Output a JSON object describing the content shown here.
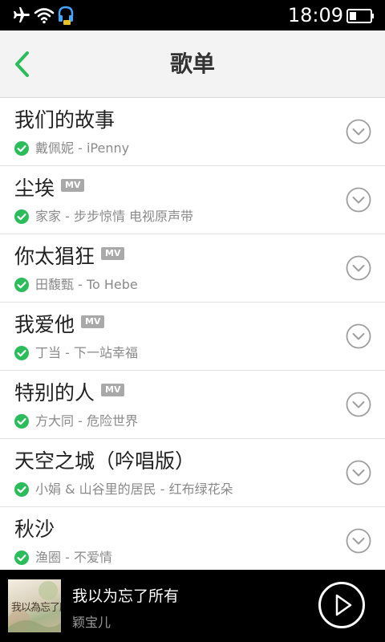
{
  "status_bar": {
    "time": "18:09",
    "icons": [
      "airplane-icon",
      "wifi-icon",
      "headset-notification-icon",
      "battery-icon"
    ]
  },
  "header": {
    "title": "歌单",
    "back_icon": "chevron-left-icon"
  },
  "colors": {
    "accent_green": "#2bbd5a",
    "mv_badge": "#a9a9a9"
  },
  "songs": [
    {
      "title": "我们的故事",
      "mv": false,
      "subtitle": "戴佩妮 - iPenny"
    },
    {
      "title": "尘埃",
      "mv": true,
      "mv_label": "MV",
      "subtitle": "家家 - 步步惊情 电视原声带"
    },
    {
      "title": "你太猖狂",
      "mv": true,
      "mv_label": "MV",
      "subtitle": "田馥甄 - To Hebe"
    },
    {
      "title": "我爱他",
      "mv": true,
      "mv_label": "MV",
      "subtitle": "丁当 - 下一站幸福"
    },
    {
      "title": "特别的人",
      "mv": true,
      "mv_label": "MV",
      "subtitle": "方大同 - 危险世界"
    },
    {
      "title": "天空之城（吟唱版）",
      "mv": false,
      "subtitle": "小娟 & 山谷里的居民 - 红布绿花朵"
    },
    {
      "title": "秋沙",
      "mv": false,
      "subtitle": "渔圈 - 不爱情"
    }
  ],
  "now_playing": {
    "title": "我以为忘了所有",
    "artist": "颖宝儿",
    "album_art_text": "我以為忘了所有"
  }
}
